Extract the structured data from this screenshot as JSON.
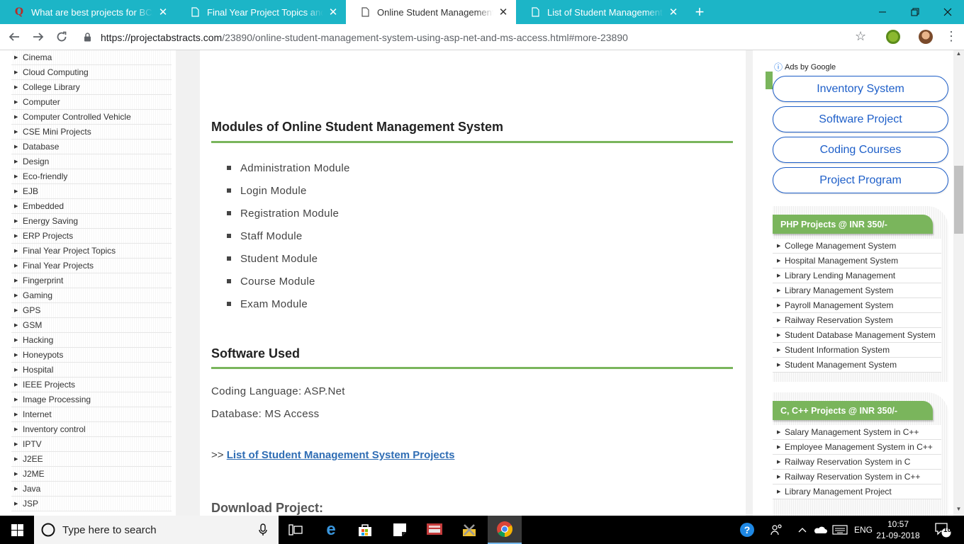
{
  "browser": {
    "tabs": [
      {
        "title": "What are best projects for BCA st",
        "icon": "quora-icon",
        "active": false
      },
      {
        "title": "Final Year Project Topics and Idea",
        "icon": "page-icon",
        "active": false
      },
      {
        "title": "Online Student Management Sys",
        "icon": "page-icon",
        "active": true
      },
      {
        "title": "List of Student Management Syst",
        "icon": "page-icon",
        "active": false
      }
    ],
    "close_glyph": "✕",
    "new_tab_glyph": "+",
    "url_host": "https://projectabstracts.com",
    "url_path": "/23890/online-student-management-system-using-asp-net-and-ms-access.html#more-23890"
  },
  "sidebar": {
    "items": [
      "Cinema",
      "Cloud Computing",
      "College Library",
      "Computer",
      "Computer Controlled Vehicle",
      "CSE Mini Projects",
      "Database",
      "Design",
      "Eco-friendly",
      "EJB",
      "Embedded",
      "Energy Saving",
      "ERP Projects",
      "Final Year Project Topics",
      "Final Year Projects",
      "Fingerprint",
      "Gaming",
      "GPS",
      "GSM",
      "Hacking",
      "Honeypots",
      "Hospital",
      "IEEE Projects",
      "Image Processing",
      "Internet",
      "Inventory control",
      "IPTV",
      "J2EE",
      "J2ME",
      "Java",
      "JSP"
    ]
  },
  "article": {
    "modules_heading": "Modules of Online Student Management System",
    "modules": [
      "Administration Module",
      "Login Module",
      "Registration Module",
      "Staff Module",
      "Student Module",
      "Course Module",
      "Exam Module"
    ],
    "software_heading": "Software Used",
    "coding_language": "Coding Language: ASP.Net",
    "database": "Database: MS Access",
    "link_prefix": ">>",
    "link_text": "List of Student Management System Projects",
    "download_heading": "Download Project:"
  },
  "ads": {
    "ads_by": "Ads by Google",
    "buttons": [
      "Inventory System",
      "Software Project",
      "Coding Courses",
      "Project Program"
    ]
  },
  "php_box": {
    "title": "PHP Projects @ INR 350/-",
    "items": [
      "College Management System",
      "Hospital Management System",
      "Library Lending Management",
      "Library Management System",
      "Payroll Management System",
      "Railway Reservation System",
      "Student Database Management System",
      "Student Information System",
      "Student Management System"
    ]
  },
  "cpp_box": {
    "title": "C, C++ Projects @ INR 350/-",
    "items": [
      "Salary Management System in C++",
      "Employee Management System in C++",
      "Railway Reservation System in C",
      "Railway Reservation System in C++",
      "Library Management Project"
    ]
  },
  "taskbar": {
    "search_placeholder": "Type here to search",
    "language": "ENG",
    "time": "10:57",
    "date": "21-09-2018",
    "notification_count": "10"
  },
  "colors": {
    "tab_bar": "#1cb5c7",
    "accent_green": "#7ab55c",
    "ad_blue": "#1e5fc9",
    "link_blue": "#2f6db4"
  }
}
